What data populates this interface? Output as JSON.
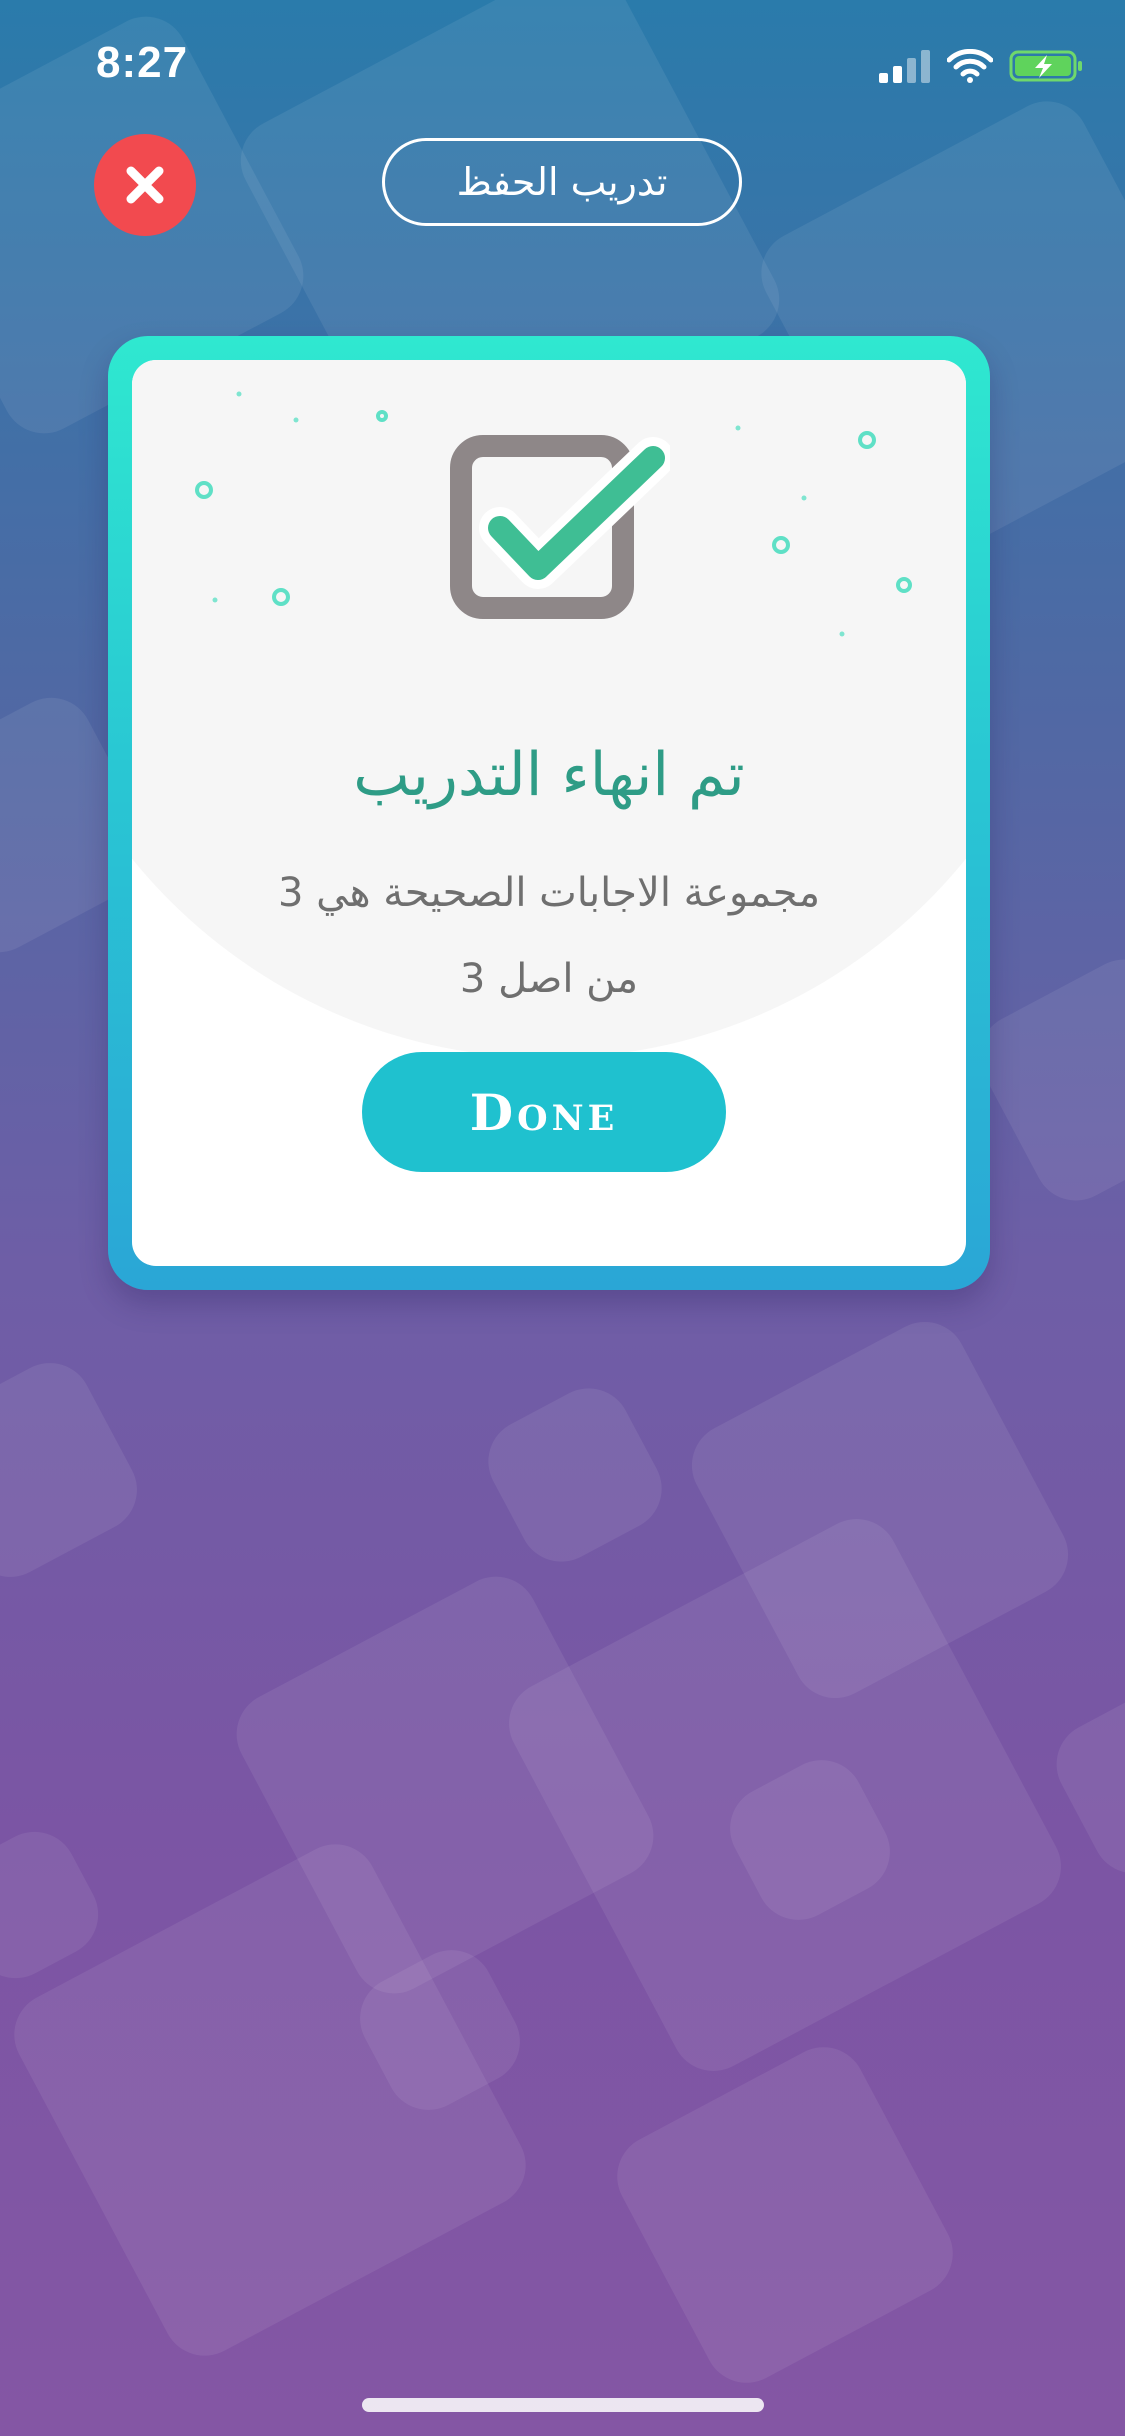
{
  "status_bar": {
    "time": "8:27",
    "icons": [
      "cellular-signal-icon",
      "wifi-icon",
      "battery-charging-icon"
    ]
  },
  "header": {
    "close_icon": "close-icon",
    "title": "تدريب الحفظ"
  },
  "card": {
    "icon": "checkbox-checked-icon",
    "title": "تم انهاء التدريب",
    "message_line1": "مجموعة الاجابات الصحيحة هي 3",
    "message_line2": "من اصل 3",
    "done_label": "Done"
  },
  "colors": {
    "close": "#f24a4f",
    "accent": "#1fc1cf",
    "title": "#2e9c86",
    "card_border_top": "#2fe8d0",
    "card_border_bottom": "#2aa6d6"
  }
}
